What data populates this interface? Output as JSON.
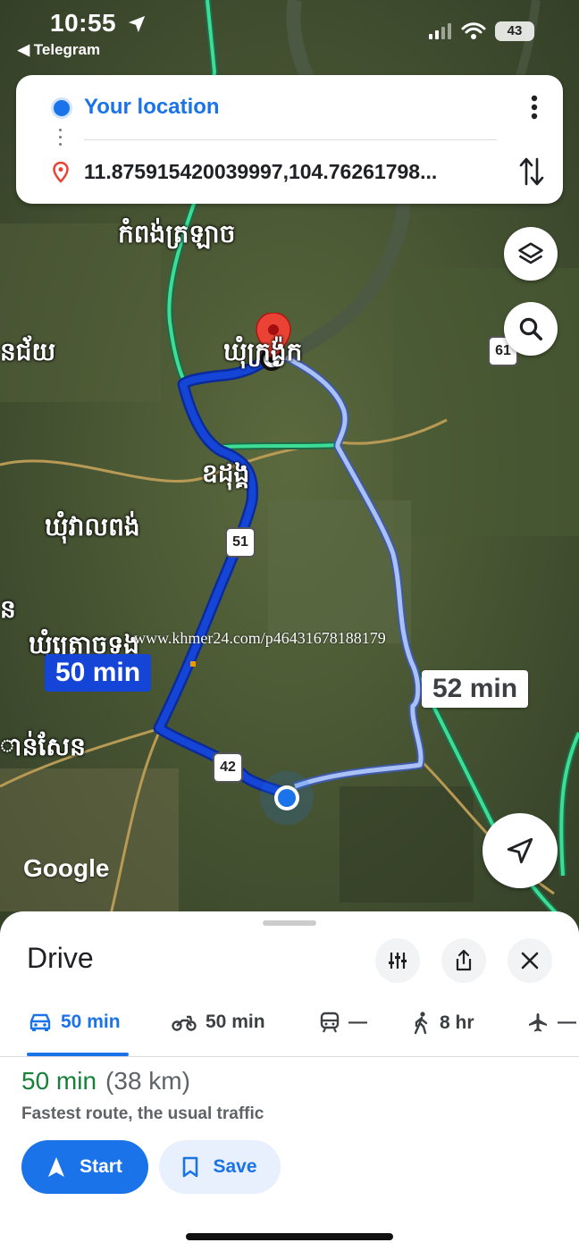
{
  "status_bar": {
    "time": "10:55",
    "back_app": "◀ Telegram",
    "battery": "43"
  },
  "search": {
    "origin": "Your location",
    "destination": "11.875915420039997,104.76261798..."
  },
  "map": {
    "labels": {
      "place_north": "កំពង់ត្រឡាច",
      "place_left_top": "នជ័យ",
      "place_pin": "ឃុំក្រង្ង៉ក",
      "place_mid": "ឧដុង្គ",
      "place_left_mid": "ឃុំវាលពង់",
      "place_left_edge": "ន",
      "place_tadong": "ឃុំត្រោចទង",
      "place_left_low": "ាន់សែន"
    },
    "road_shields": {
      "r61": "61",
      "r51": "51",
      "r42": "42"
    },
    "route_time_main": "50 min",
    "route_time_alt": "52 min",
    "watermark": "www.khmer24.com/p46431678188179",
    "logo": "Google"
  },
  "sheet": {
    "title": "Drive",
    "modes": [
      {
        "name": "car",
        "label": "50 min",
        "active": true
      },
      {
        "name": "motorcycle",
        "label": "50 min",
        "active": false
      },
      {
        "name": "transit",
        "label": "—",
        "active": false
      },
      {
        "name": "walk",
        "label": "8 hr",
        "active": false
      },
      {
        "name": "flight",
        "label": "—",
        "active": false
      }
    ],
    "duration": "50 min",
    "distance": "(38 km)",
    "description": "Fastest route, the usual traffic",
    "start_label": "Start",
    "save_label": "Save"
  },
  "colors": {
    "accent": "#1a73e8",
    "route_main": "#1545d6",
    "route_alt": "#a9c1f5",
    "highway": "#3ddc97",
    "pin": "#ea4335",
    "duration": "#188038"
  }
}
